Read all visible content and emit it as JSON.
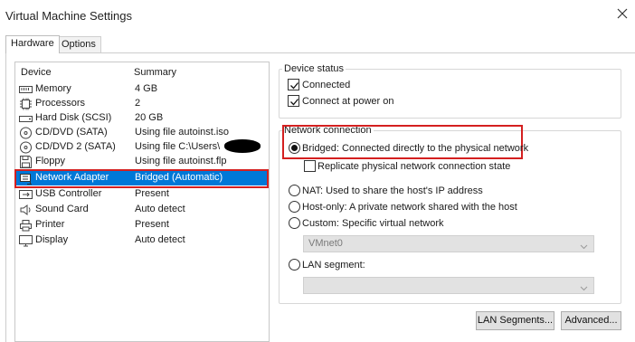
{
  "window": {
    "title": "Virtual Machine Settings",
    "close_icon": "close-icon"
  },
  "tabs": [
    {
      "label": "Hardware"
    },
    {
      "label": "Options"
    }
  ],
  "device_list": {
    "columns": {
      "device": "Device",
      "summary": "Summary"
    },
    "rows": [
      {
        "name": "Memory",
        "summary": "4 GB",
        "icon": "memory-icon"
      },
      {
        "name": "Processors",
        "summary": "2",
        "icon": "processor-icon"
      },
      {
        "name": "Hard Disk (SCSI)",
        "summary": "20 GB",
        "icon": "hard-disk-icon"
      },
      {
        "name": "CD/DVD (SATA)",
        "summary": "Using file autoinst.iso",
        "icon": "cd-dvd-icon"
      },
      {
        "name": "CD/DVD 2 (SATA)",
        "summary": "Using file C:\\Users\\",
        "icon": "cd-dvd-icon"
      },
      {
        "name": "Floppy",
        "summary": "Using file autoinst.flp",
        "icon": "floppy-icon"
      },
      {
        "name": "Network Adapter",
        "summary": "Bridged (Automatic)",
        "icon": "network-adapter-icon",
        "selected": true
      },
      {
        "name": "USB Controller",
        "summary": "Present",
        "icon": "usb-icon"
      },
      {
        "name": "Sound Card",
        "summary": "Auto detect",
        "icon": "speaker-icon"
      },
      {
        "name": "Printer",
        "summary": "Present",
        "icon": "printer-icon"
      },
      {
        "name": "Display",
        "summary": "Auto detect",
        "icon": "display-icon"
      }
    ]
  },
  "device_status": {
    "title": "Device status",
    "connected": {
      "label": "Connected",
      "checked": true
    },
    "connect_at_power_on": {
      "label": "Connect at power on",
      "checked": true
    }
  },
  "network_connection": {
    "title": "Network connection",
    "bridged": {
      "label": "Bridged: Connected directly to the physical network",
      "selected": true
    },
    "replicate": {
      "label": "Replicate physical network connection state",
      "checked": false
    },
    "nat": {
      "label": "NAT: Used to share the host's IP address",
      "selected": false
    },
    "host_only": {
      "label": "Host-only: A private network shared with the host",
      "selected": false
    },
    "custom": {
      "label": "Custom: Specific virtual network",
      "selected": false
    },
    "custom_combo": {
      "value": "VMnet0"
    },
    "lan_segment": {
      "label": "LAN segment:",
      "selected": false
    },
    "lan_combo": {
      "value": ""
    }
  },
  "buttons": {
    "lan_segments": "LAN Segments...",
    "advanced": "Advanced..."
  },
  "colors": {
    "selection": "#0078d7",
    "highlight_box": "#d42020"
  }
}
